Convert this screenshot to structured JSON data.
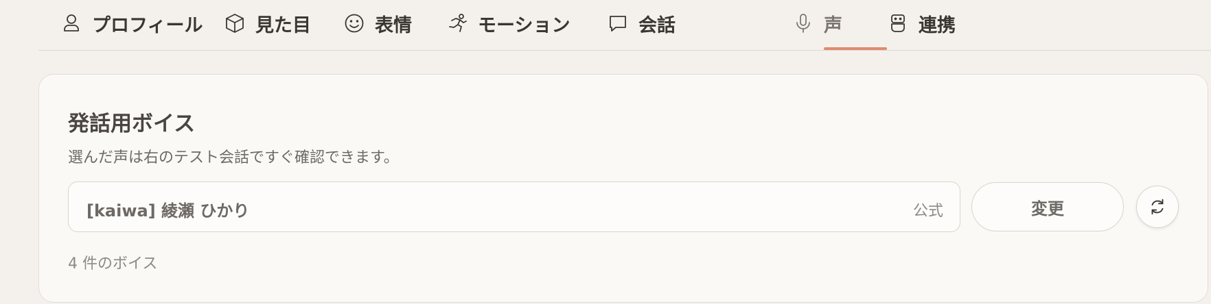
{
  "tabs": [
    {
      "label": "プロフィール",
      "icon": "user-icon"
    },
    {
      "label": "見た目",
      "icon": "cube-icon"
    },
    {
      "label": "表情",
      "icon": "smile-icon"
    },
    {
      "label": "モーション",
      "icon": "running-icon"
    },
    {
      "label": "会話",
      "icon": "chat-bubble-icon"
    },
    {
      "label": "声",
      "icon": "microphone-icon",
      "active": true
    },
    {
      "label": "連携",
      "icon": "robot-icon"
    }
  ],
  "colors": {
    "accent": "#e08a70",
    "background": "#f4f1ed",
    "card": "#fbf9f6",
    "text": "#3a3632",
    "muted": "#8e8983"
  },
  "voice_section": {
    "title": "発話用ボイス",
    "subtitle": "選んだ声は右のテスト会話ですぐ確認できます。",
    "selected_voice": "[kaiwa] 綾瀬 ひかり",
    "badge": "公式",
    "change_label": "変更",
    "refresh_icon": "refresh-icon",
    "count_text": "4 件のボイス"
  }
}
